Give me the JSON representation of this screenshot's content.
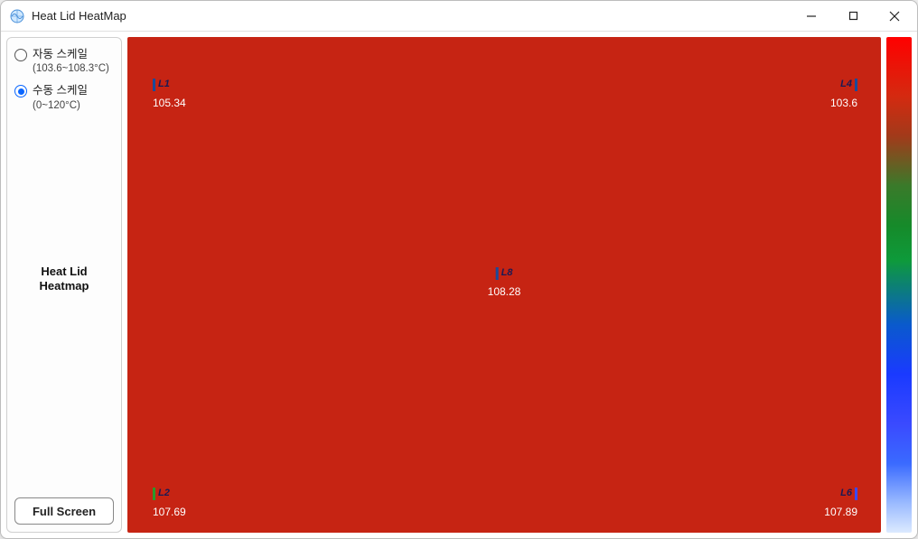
{
  "window": {
    "title": "Heat Lid HeatMap"
  },
  "sidebar": {
    "scale_options": [
      {
        "label": "자동 스케일",
        "range": "(103.6~108.3°C)",
        "selected": false
      },
      {
        "label": "수동 스케일",
        "range": "(0~120°C)",
        "selected": true
      }
    ],
    "panel_title_line1": "Heat Lid",
    "panel_title_line2": "Heatmap",
    "fullscreen_button": "Full Screen"
  },
  "chart_data": {
    "type": "heatmap",
    "title": "Heat Lid Heatmap",
    "color_scale": {
      "min": 0,
      "max": 120,
      "unit": "°C"
    },
    "data_range": {
      "min": 103.6,
      "max": 108.3
    },
    "sensors": [
      {
        "id": "L1",
        "value": 105.34,
        "pos": "top-left"
      },
      {
        "id": "L4",
        "value": 103.6,
        "pos": "top-right"
      },
      {
        "id": "L8",
        "value": 108.28,
        "pos": "center"
      },
      {
        "id": "L2",
        "value": 107.69,
        "pos": "bottom-left"
      },
      {
        "id": "L6",
        "value": 107.89,
        "pos": "bottom-right"
      }
    ]
  },
  "colors": {
    "heatmap_bg": "#c62413",
    "accent": "#0a66ff",
    "sensor_bars": {
      "L1": [
        "#1a4a9a",
        "#c62413"
      ],
      "L4": [
        "#c62413",
        "#1a4a9a"
      ],
      "L8": [
        "#1a4a9a",
        "#c62413"
      ],
      "L2": [
        "#2a9a2a",
        "#c62413"
      ],
      "L6": [
        "#c62413",
        "#3a4aff"
      ]
    }
  }
}
